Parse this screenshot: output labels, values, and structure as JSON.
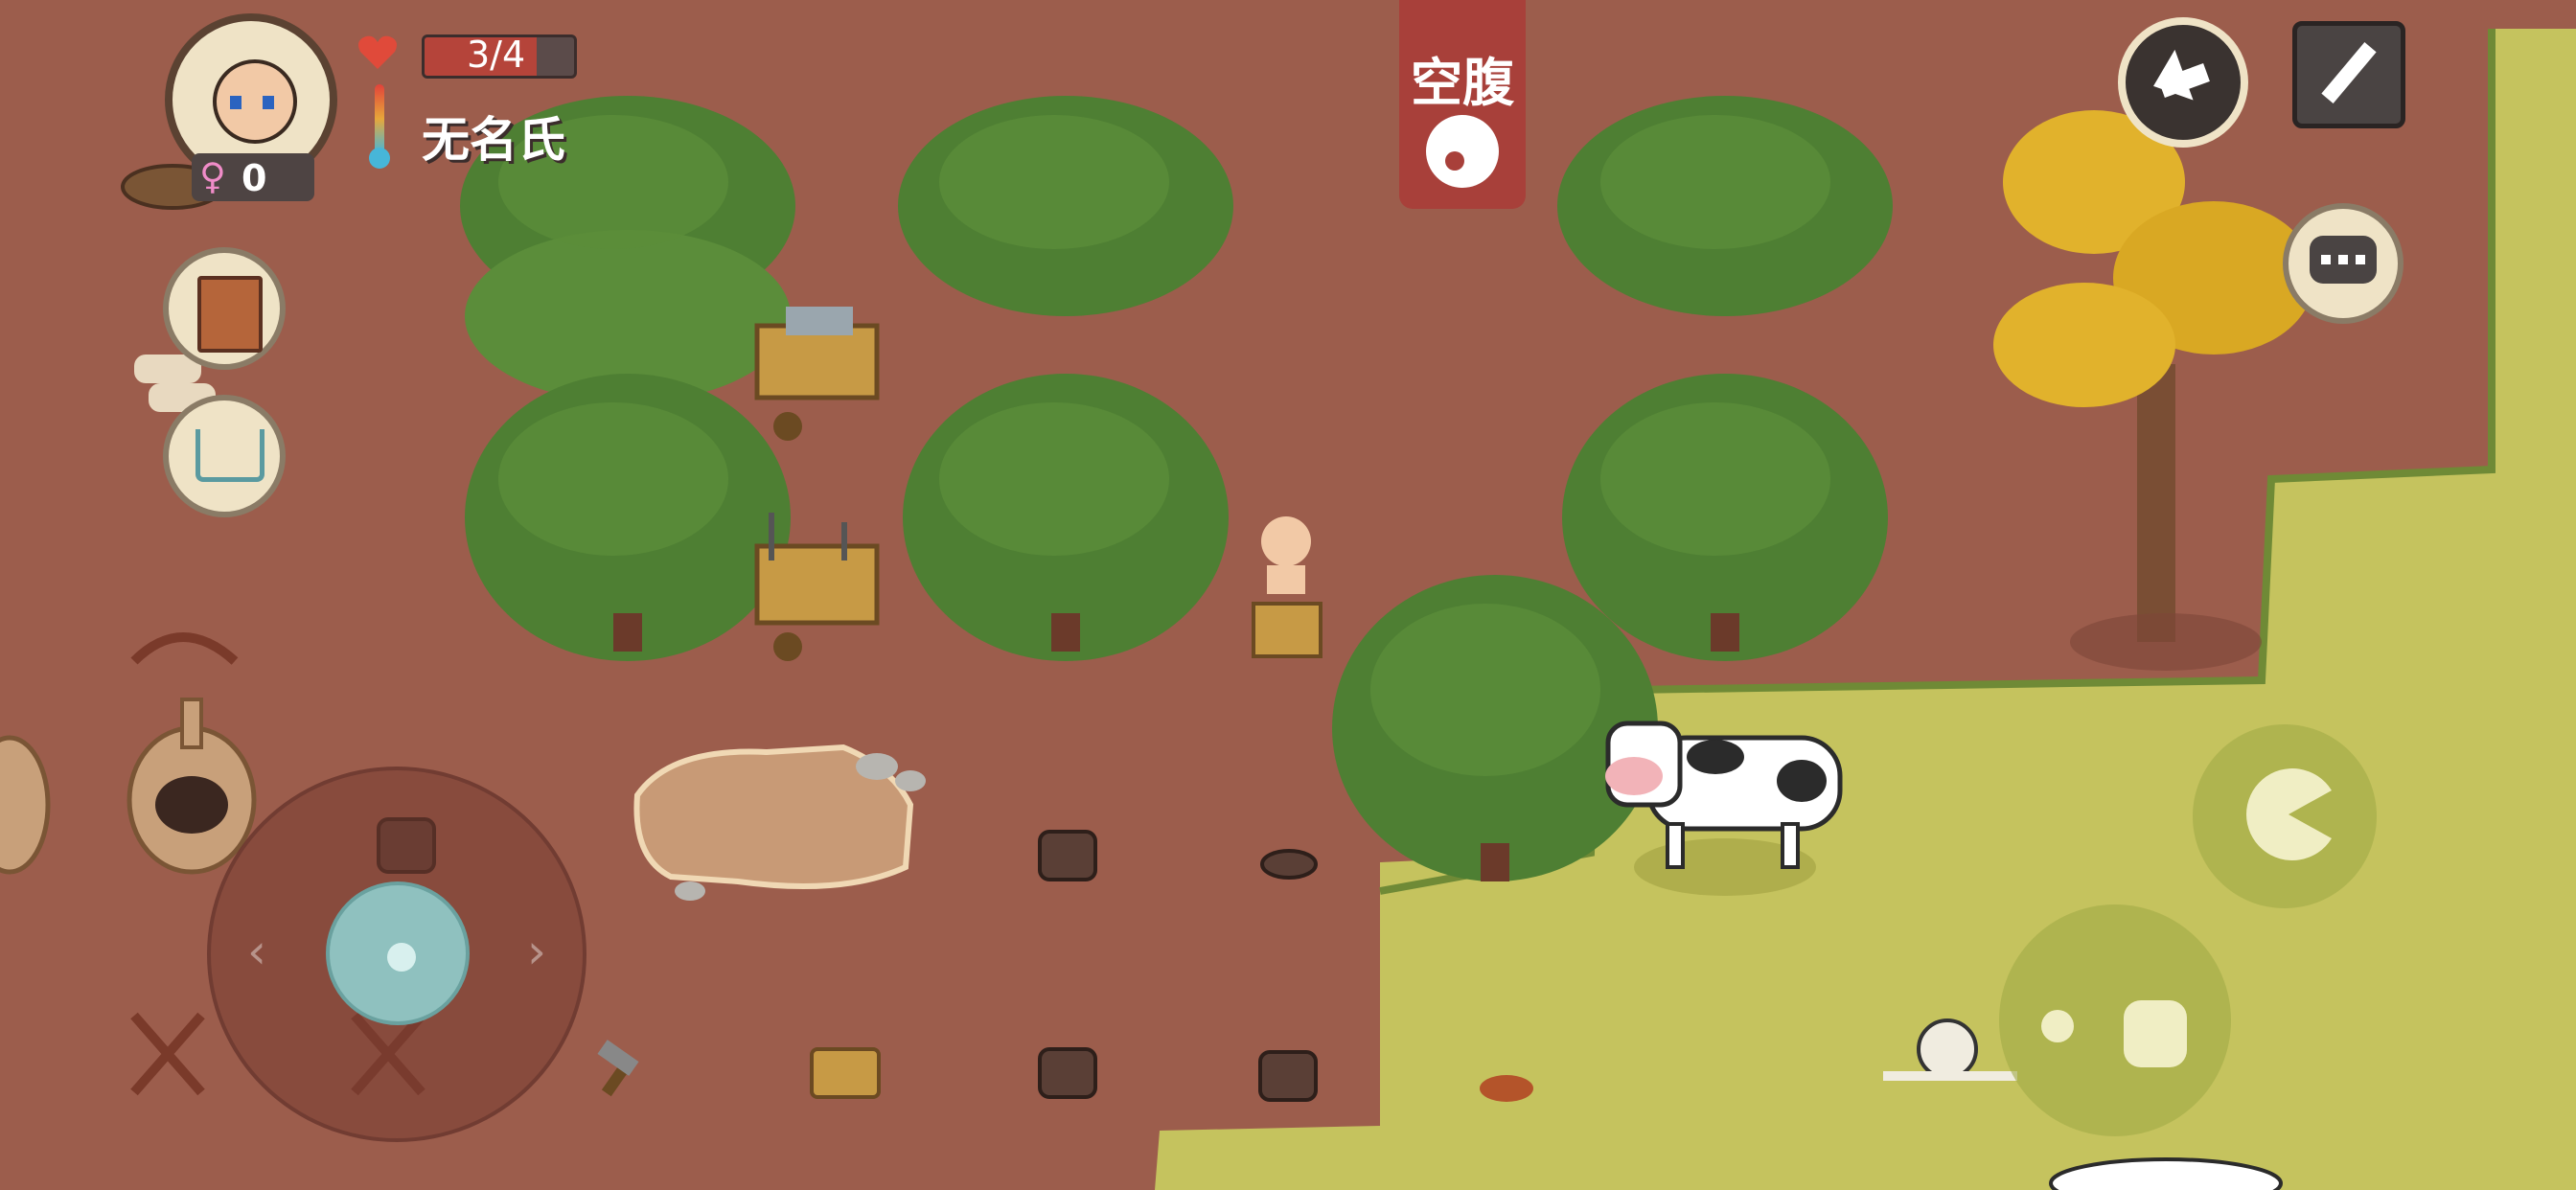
{
  "player": {
    "name": "无名氏",
    "health_text": "3/4",
    "health_fraction": 0.75,
    "generation_count": "0",
    "gender_symbol": "♀"
  },
  "status": {
    "hunger_label": "空腹"
  },
  "colors": {
    "dirt": "#9c5d4c",
    "grass": "#c5c35e",
    "tree_green": "#4e7f33",
    "status_red": "#a8403a",
    "hud_cream": "#efe3c6"
  },
  "icons": {
    "back": "back-arrow-icon",
    "settings": "wrench-icon",
    "chat": "chat-bubble-icon",
    "eat": "pacman-eat-icon",
    "use": "throw-hand-icon",
    "journal": "book-icon",
    "shop": "cart-icon"
  }
}
